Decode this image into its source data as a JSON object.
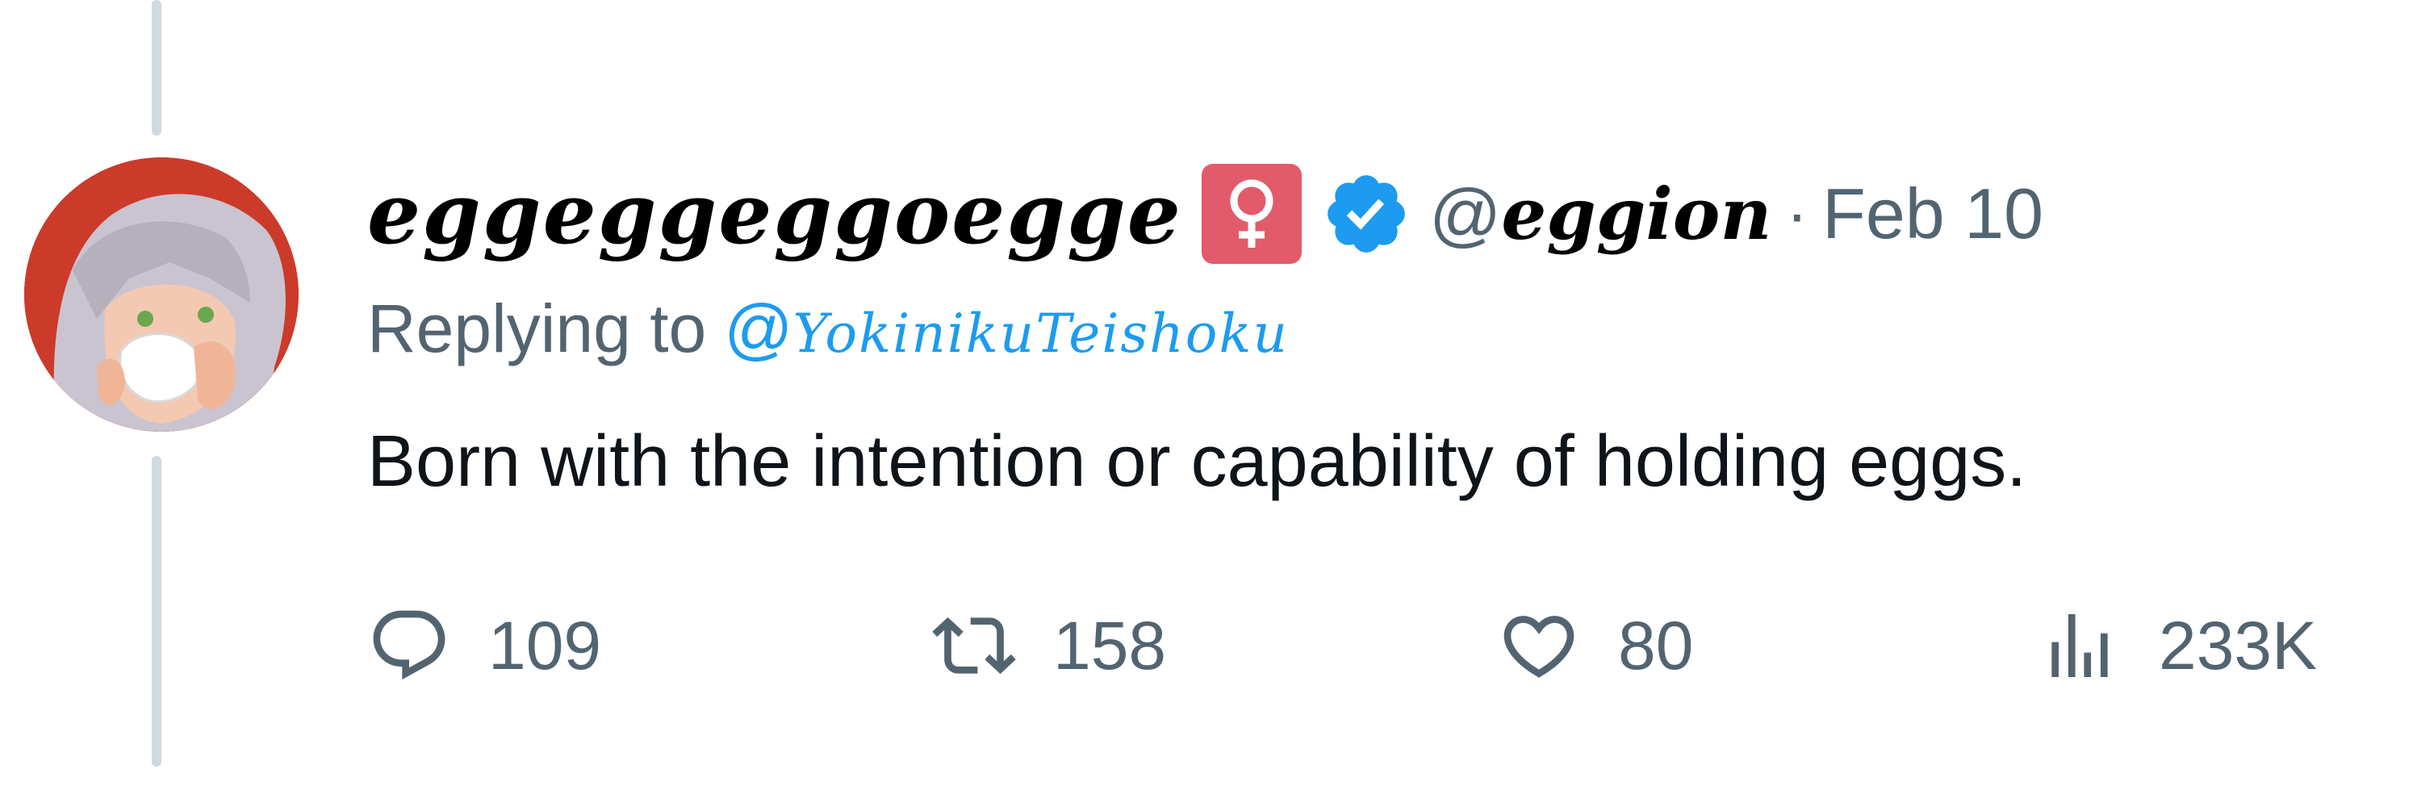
{
  "tweet": {
    "display_name": "eggeggeggoegge",
    "handle_at": "@",
    "handle_name": "eggion",
    "separator": "·",
    "date": "Feb 10",
    "replying_label": "Replying to",
    "replying_at": "@",
    "replying_to": "YokinikuTeishoku",
    "text": "Born with the intention or capability of holding eggs.",
    "stats": {
      "replies": "109",
      "retweets": "158",
      "likes": "80",
      "views": "233K"
    }
  },
  "icons": {
    "gender": "female-sign-icon",
    "verified": "verified-badge-icon",
    "reply": "reply-icon",
    "retweet": "retweet-icon",
    "like": "heart-icon",
    "views": "views-icon"
  },
  "colors": {
    "accent": "#1d9bf0",
    "muted": "#536471",
    "gender_badge": "#e25b6b",
    "avatar_bg": "#cc3a2a"
  }
}
